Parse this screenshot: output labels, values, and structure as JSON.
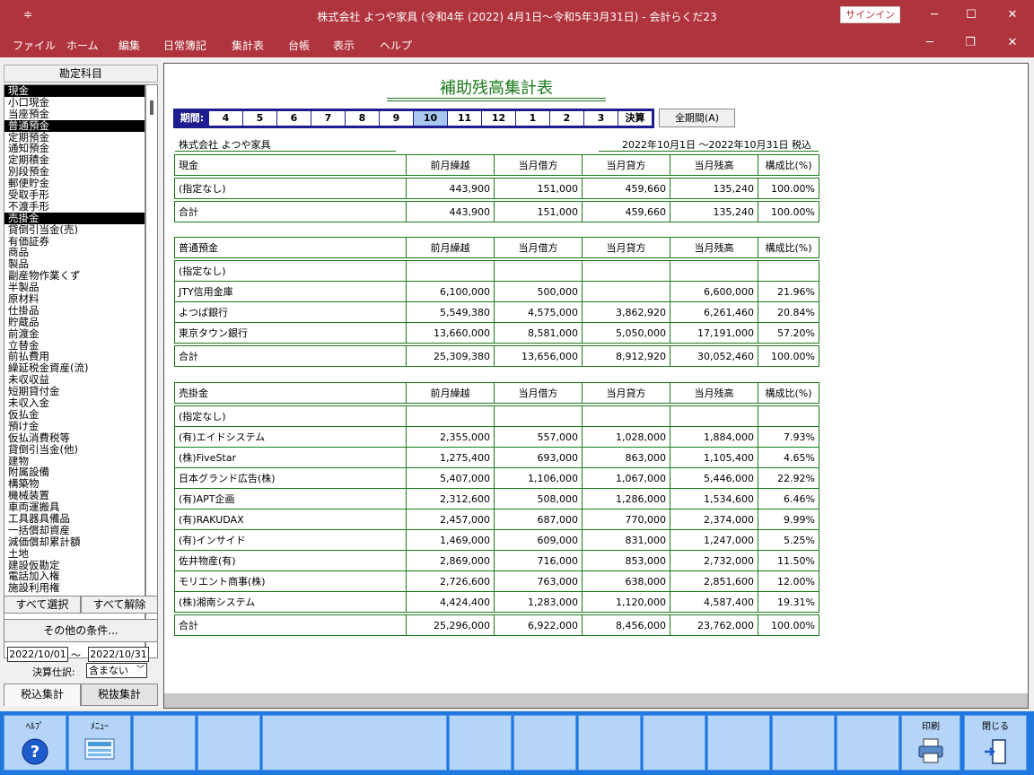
{
  "window": {
    "title": "株式会社 よつや家具 (令和4年 (2022) 4月1日〜令和5年3月31日)  -  会計らくだ23",
    "signin": "サインイン"
  },
  "menu": [
    "ファイル",
    "ホーム",
    "編集",
    "日常簿記",
    "集計表",
    "台帳",
    "表示",
    "ヘルプ"
  ],
  "left": {
    "header": "勘定科目",
    "accounts": [
      {
        "label": "現金",
        "selected": true
      },
      {
        "label": "小口現金",
        "selected": false
      },
      {
        "label": "当座預金",
        "selected": false
      },
      {
        "label": "普通預金",
        "selected": true
      },
      {
        "label": "定期預金",
        "selected": false
      },
      {
        "label": "通知預金",
        "selected": false
      },
      {
        "label": "定期積金",
        "selected": false
      },
      {
        "label": "別段預金",
        "selected": false
      },
      {
        "label": "郵便貯金",
        "selected": false
      },
      {
        "label": "受取手形",
        "selected": false
      },
      {
        "label": "不渡手形",
        "selected": false
      },
      {
        "label": "売掛金",
        "selected": true
      },
      {
        "label": "貸倒引当金(売)",
        "selected": false
      },
      {
        "label": "有価証券",
        "selected": false
      },
      {
        "label": "商品",
        "selected": false
      },
      {
        "label": "製品",
        "selected": false
      },
      {
        "label": "副産物作業くず",
        "selected": false
      },
      {
        "label": "半製品",
        "selected": false
      },
      {
        "label": "原材料",
        "selected": false
      },
      {
        "label": "仕掛品",
        "selected": false
      },
      {
        "label": "貯蔵品",
        "selected": false
      },
      {
        "label": "前渡金",
        "selected": false
      },
      {
        "label": "立替金",
        "selected": false
      },
      {
        "label": "前払費用",
        "selected": false
      },
      {
        "label": "繰延税金資産(流)",
        "selected": false
      },
      {
        "label": "未収収益",
        "selected": false
      },
      {
        "label": "短期貸付金",
        "selected": false
      },
      {
        "label": "未収入金",
        "selected": false
      },
      {
        "label": "仮払金",
        "selected": false
      },
      {
        "label": "預け金",
        "selected": false
      },
      {
        "label": "仮払消費税等",
        "selected": false
      },
      {
        "label": "貸倒引当金(他)",
        "selected": false
      },
      {
        "label": "建物",
        "selected": false
      },
      {
        "label": "附属設備",
        "selected": false
      },
      {
        "label": "構築物",
        "selected": false
      },
      {
        "label": "機械装置",
        "selected": false
      },
      {
        "label": "車両運搬具",
        "selected": false
      },
      {
        "label": "工具器具備品",
        "selected": false
      },
      {
        "label": "一括償却資産",
        "selected": false
      },
      {
        "label": "減価償却累計額",
        "selected": false
      },
      {
        "label": "土地",
        "selected": false
      },
      {
        "label": "建設仮勘定",
        "selected": false
      },
      {
        "label": "電話加入権",
        "selected": false
      },
      {
        "label": "施設利用権",
        "selected": false
      }
    ],
    "select_all": "すべて選択",
    "deselect_all": "すべて解除",
    "other_conditions": "その他の条件...",
    "date_from": "2022/10/01",
    "tilde": "〜",
    "date_to": "2022/10/31",
    "closing_label": "決算仕訳:",
    "closing_value": "含まない",
    "tab_tax_incl": "税込集計",
    "tab_tax_excl": "税抜集計"
  },
  "report": {
    "title": "補助残高集計表",
    "period_label": "期間:",
    "periods": [
      "4",
      "5",
      "6",
      "7",
      "8",
      "9",
      "10",
      "11",
      "12",
      "1",
      "2",
      "3",
      "決算"
    ],
    "selected_period": "10",
    "all_period": "全期間(A)",
    "company": "株式会社 よつや家具",
    "daterange": "2022年10月1日 〜2022年10月31日  税込",
    "columns": [
      "前月繰越",
      "当月借方",
      "当月貸方",
      "当月残高",
      "構成比(%)"
    ],
    "tables": [
      {
        "account": "現金",
        "rows": [
          [
            "(指定なし)",
            "443,900",
            "151,000",
            "459,660",
            "135,240",
            "100.00%"
          ]
        ],
        "total": [
          "合計",
          "443,900",
          "151,000",
          "459,660",
          "135,240",
          "100.00%"
        ]
      },
      {
        "account": "普通預金",
        "rows": [
          [
            "(指定なし)",
            "",
            "",
            "",
            "",
            ""
          ],
          [
            "JTY信用金庫",
            "6,100,000",
            "500,000",
            "",
            "6,600,000",
            "21.96%"
          ],
          [
            "よつば銀行",
            "5,549,380",
            "4,575,000",
            "3,862,920",
            "6,261,460",
            "20.84%"
          ],
          [
            "東京タウン銀行",
            "13,660,000",
            "8,581,000",
            "5,050,000",
            "17,191,000",
            "57.20%"
          ]
        ],
        "total": [
          "合計",
          "25,309,380",
          "13,656,000",
          "8,912,920",
          "30,052,460",
          "100.00%"
        ]
      },
      {
        "account": "売掛金",
        "rows": [
          [
            "(指定なし)",
            "",
            "",
            "",
            "",
            ""
          ],
          [
            "(有)エイドシステム",
            "2,355,000",
            "557,000",
            "1,028,000",
            "1,884,000",
            "7.93%"
          ],
          [
            "(株)FiveStar",
            "1,275,400",
            "693,000",
            "863,000",
            "1,105,400",
            "4.65%"
          ],
          [
            "日本グランド広告(株)",
            "5,407,000",
            "1,106,000",
            "1,067,000",
            "5,446,000",
            "22.92%"
          ],
          [
            "(有)APT企画",
            "2,312,600",
            "508,000",
            "1,286,000",
            "1,534,600",
            "6.46%"
          ],
          [
            "(有)RAKUDAX",
            "2,457,000",
            "687,000",
            "770,000",
            "2,374,000",
            "9.99%"
          ],
          [
            "(有)インサイド",
            "1,469,000",
            "609,000",
            "831,000",
            "1,247,000",
            "5.25%"
          ],
          [
            "佐井物産(有)",
            "2,869,000",
            "716,000",
            "853,000",
            "2,732,000",
            "11.50%"
          ],
          [
            "モリエント商事(株)",
            "2,726,600",
            "763,000",
            "638,000",
            "2,851,600",
            "12.00%"
          ],
          [
            "(株)湘南システム",
            "4,424,400",
            "1,283,000",
            "1,120,000",
            "4,587,400",
            "19.31%"
          ]
        ],
        "total": [
          "合計",
          "25,296,000",
          "6,922,000",
          "8,456,000",
          "23,762,000",
          "100.00%"
        ]
      }
    ]
  },
  "footer": {
    "help": "ﾍﾙﾌﾟ",
    "menu": "ﾒﾆｭｰ",
    "print": "印刷",
    "close": "閉じる"
  },
  "icons": [
    "app-menu-icon",
    "minimize-icon",
    "maximize-icon",
    "close-icon",
    "help-icon",
    "menu-icon",
    "print-icon",
    "exit-icon"
  ],
  "colors": {
    "titlebar": "#b0343d",
    "accent": "#1d1d8f",
    "table_border": "#1a7a1a",
    "footer": "#1e78e0"
  }
}
